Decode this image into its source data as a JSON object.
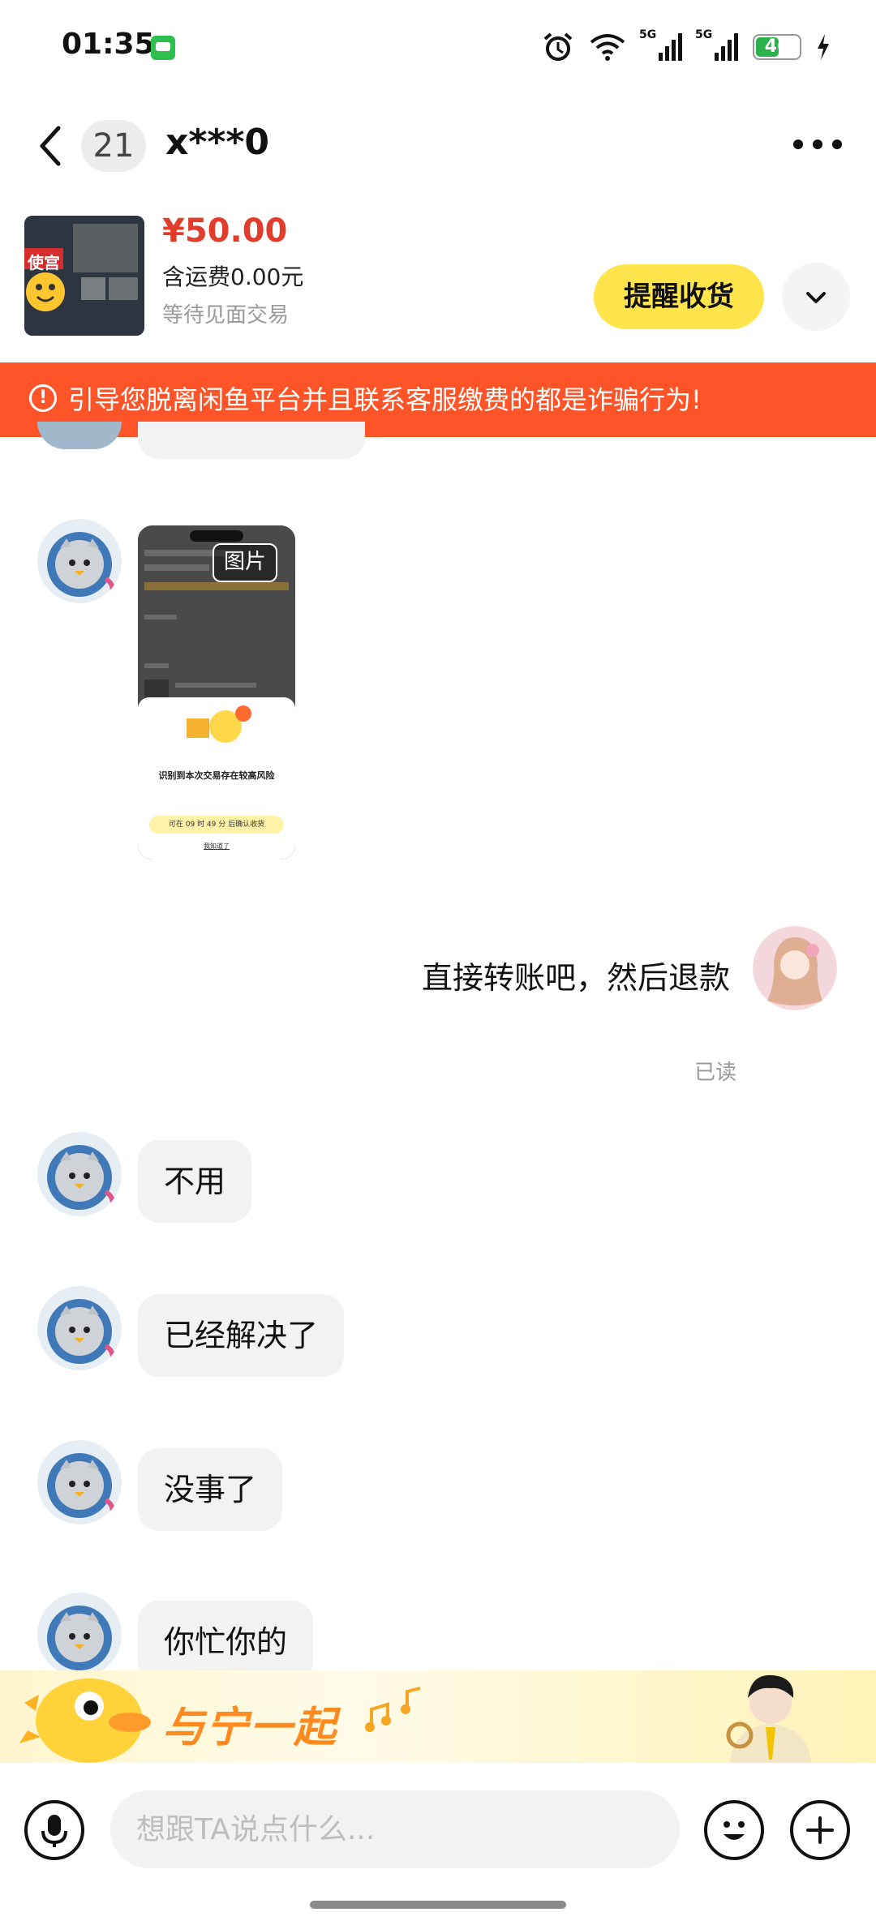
{
  "status_bar": {
    "time": "01:35",
    "network_1": "5G",
    "network_2": "5G",
    "battery": "46",
    "icons": [
      "message-icon",
      "alarm-icon",
      "wifi-icon",
      "signal-icon",
      "battery-icon",
      "charging-icon"
    ]
  },
  "header": {
    "unread_count": "21",
    "peer_name": "x***0",
    "icons": [
      "back-icon",
      "more-icon"
    ]
  },
  "product": {
    "price": "¥50.00",
    "shipping": "含运费0.00元",
    "status": "等待见面交易",
    "remind_button": "提醒收货",
    "thumb_label": "使宫",
    "icons": [
      "chevron-down-icon"
    ]
  },
  "warning": {
    "text": "引导您脱离闲鱼平台并且联系客服缴费的都是诈骗行为!"
  },
  "messages": [
    {
      "side": "left",
      "type": "image",
      "tag": "图片",
      "popup_title": "识别到本次交易存在较高风险",
      "popup_bar": "可在 09 时 49 分 后确认收货",
      "popup_link": "我知道了"
    },
    {
      "side": "right",
      "type": "text",
      "text": "直接转账吧，然后退款",
      "receipt": "已读"
    },
    {
      "side": "left",
      "type": "text",
      "text": "不用"
    },
    {
      "side": "left",
      "type": "text",
      "text": "已经解决了"
    },
    {
      "side": "left",
      "type": "text",
      "text": "没事了"
    },
    {
      "side": "left",
      "type": "text",
      "text": "你忙你的"
    }
  ],
  "banner": {
    "slogan": "与宁一起"
  },
  "input_bar": {
    "placeholder": "想跟TA说点什么...",
    "icons": [
      "microphone-icon",
      "emoji-icon",
      "plus-icon"
    ]
  },
  "colors": {
    "price": "#e23d2a",
    "remind_button": "#ffe44b",
    "warning_bg": "#fe5427",
    "bubble_bg": "#f2f2f3"
  }
}
